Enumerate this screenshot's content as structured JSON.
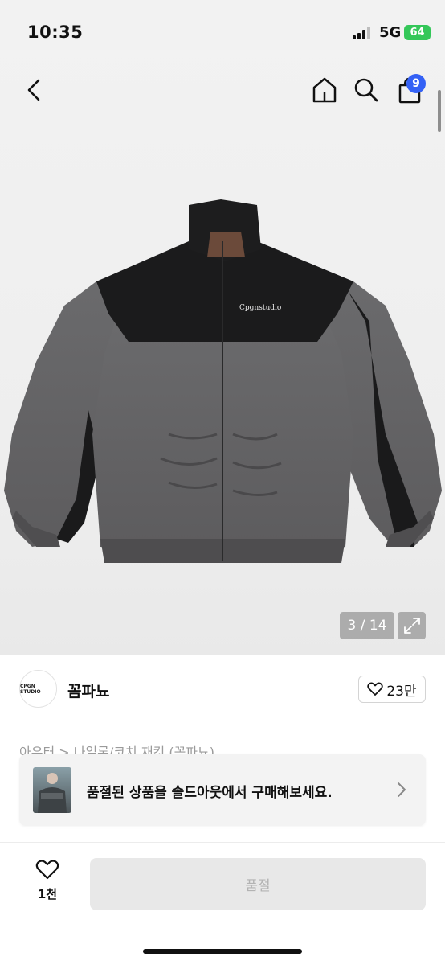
{
  "status_bar": {
    "time": "10:35",
    "network": "5G",
    "battery": "64"
  },
  "header": {
    "back_icon": "chevron-left-icon",
    "home_icon": "home-icon",
    "search_icon": "search-icon",
    "cart_icon": "shopping-bag-icon",
    "cart_badge": "9"
  },
  "gallery": {
    "counter": "3 / 14",
    "fullscreen_icon": "expand-icon"
  },
  "seller": {
    "logo_text": "CPGN STUDIO",
    "name": "꼼파뇨",
    "likes": "23만"
  },
  "breadcrumb": "아우터 > 나일론/코치 재킷 (꼼파뇨)",
  "banner": {
    "message": "품절된 상품을 솔드아웃에서 구매해보세요."
  },
  "bottom_bar": {
    "wish_count": "1천",
    "buy_label": "품절"
  },
  "colors": {
    "accent": "#3461f5",
    "battery": "#34c759"
  }
}
